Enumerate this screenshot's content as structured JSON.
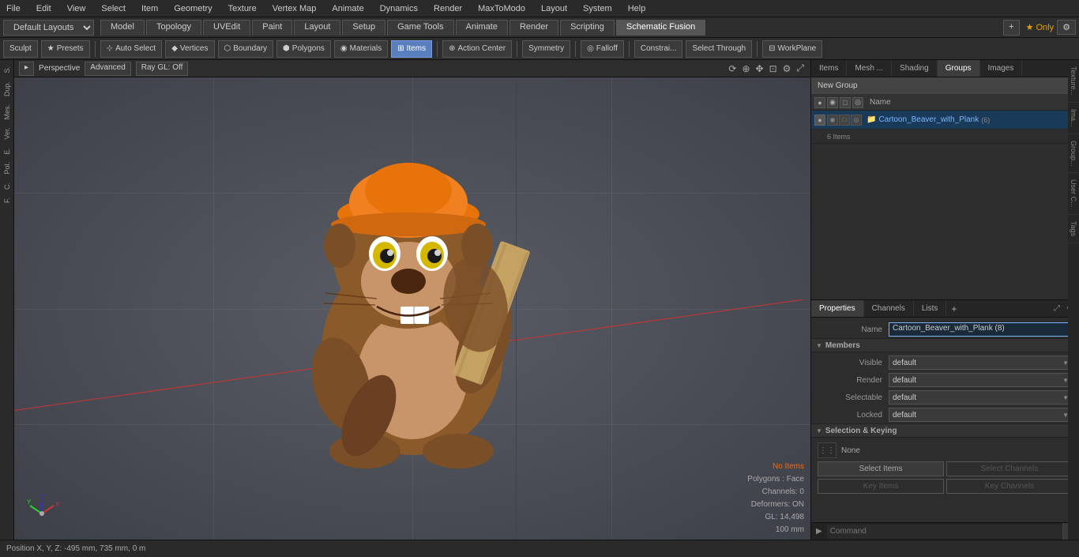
{
  "menuBar": {
    "items": [
      "File",
      "Edit",
      "View",
      "Select",
      "Item",
      "Geometry",
      "Texture",
      "Vertex Map",
      "Animate",
      "Dynamics",
      "Render",
      "MaxToModo",
      "Layout",
      "System",
      "Help"
    ]
  },
  "layoutBar": {
    "selector": "Default Layouts",
    "tabs": [
      {
        "label": "Model",
        "active": false
      },
      {
        "label": "Topology",
        "active": false
      },
      {
        "label": "UVEdit",
        "active": false
      },
      {
        "label": "Paint",
        "active": false
      },
      {
        "label": "Layout",
        "active": false
      },
      {
        "label": "Setup",
        "active": false
      },
      {
        "label": "Game Tools",
        "active": false
      },
      {
        "label": "Animate",
        "active": false
      },
      {
        "label": "Render",
        "active": false
      },
      {
        "label": "Scripting",
        "active": false
      },
      {
        "label": "Schematic Fusion",
        "active": true
      }
    ],
    "addBtn": "+",
    "starsOnly": "★ Only",
    "settingsBtn": "⚙"
  },
  "toolBar": {
    "sculpt": "Sculpt",
    "presets": "Presets",
    "autoSelect": "Auto Select",
    "vertices": "Vertices",
    "boundary": "Boundary",
    "polygons": "Polygons",
    "materials": "Materials",
    "items": "Items",
    "actionCenter": "Action Center",
    "symmetry": "Symmetry",
    "falloff": "Falloff",
    "constraints": "Constrai...",
    "selectThrough": "Select Through",
    "workPlane": "WorkPlane"
  },
  "viewport": {
    "title": "Perspective",
    "mode": "Advanced",
    "renderMode": "Ray GL: Off"
  },
  "statusOverlay": {
    "noItems": "No Items",
    "polygons": "Polygons : Face",
    "channels": "Channels: 0",
    "deformers": "Deformers: ON",
    "gl": "GL: 14,498",
    "size": "100 mm"
  },
  "statusBar": {
    "text": "Position X, Y, Z:  -495 mm, 735 mm, 0 m"
  },
  "rightPanel": {
    "tabs": [
      "Items",
      "Mesh ...",
      "Shading",
      "Groups",
      "Images"
    ],
    "activeTab": "Groups",
    "newGroupBtn": "New Group",
    "headerName": "Name",
    "groupIconBtns": [
      "●",
      "◉",
      "□",
      "◎"
    ],
    "groups": [
      {
        "name": "Cartoon_Beaver_with_Plank",
        "count": "(6)",
        "subtext": "6 Items",
        "selected": true
      }
    ]
  },
  "propertiesPanel": {
    "tabs": [
      "Properties",
      "Channels",
      "Lists"
    ],
    "activeTab": "Properties",
    "addBtn": "+",
    "nameLabel": "Name",
    "nameValue": "Cartoon_Beaver_with_Plank (8)",
    "sections": {
      "members": {
        "title": "Members",
        "visible": {
          "label": "Visible",
          "value": "default"
        },
        "render": {
          "label": "Render",
          "value": "default"
        },
        "selectable": {
          "label": "Selectable",
          "value": "default"
        },
        "locked": {
          "label": "Locked",
          "value": "default"
        }
      },
      "selectionKeying": {
        "title": "Selection & Keying",
        "noneIcon": "⋮⋮",
        "noneLabel": "None",
        "selectItems": "Select Items",
        "selectChannels": "Select Channels",
        "keyItems": "Key Items",
        "keyChannels": "Key Channels"
      }
    }
  },
  "sideTabs": [
    "Texture...",
    "Ima...",
    "Group...",
    "User C...",
    "Tags"
  ],
  "commandBar": {
    "arrow": "▶",
    "placeholder": "Command",
    "btn": "⊕"
  },
  "leftPanel": {
    "items": [
      "S.",
      "Dup.",
      "Mes.",
      "Ver.",
      "E.",
      "Pol.",
      "C.",
      "F."
    ]
  }
}
